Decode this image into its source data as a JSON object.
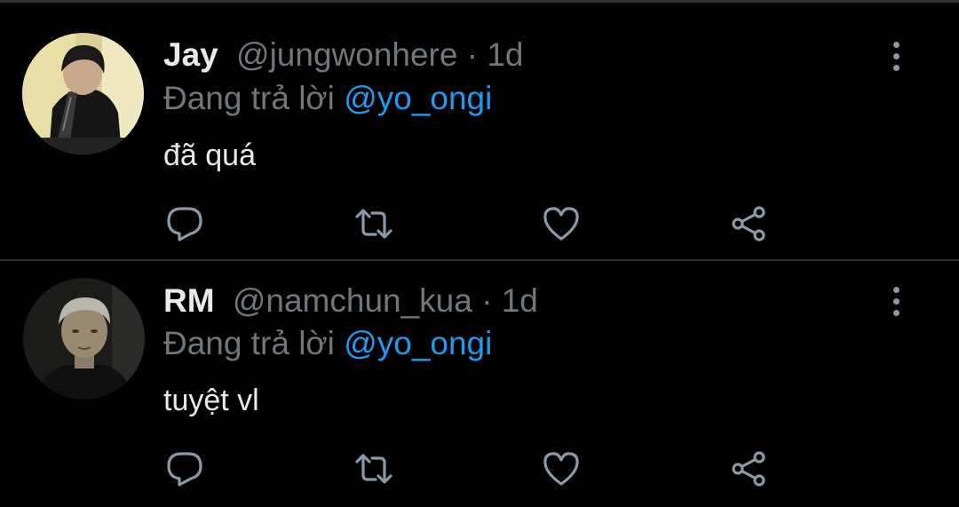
{
  "tweets": [
    {
      "display_name": "Jay",
      "handle": "@jungwonhere",
      "separator": "·",
      "time": "1d",
      "replying_prefix": "Đang trả lời",
      "replying_to": "@yo_ongi",
      "text": "đã quá",
      "avatar_icon": "avatar-photo"
    },
    {
      "display_name": "RM",
      "handle": "@namchun_kua",
      "separator": "·",
      "time": "1d",
      "replying_prefix": "Đang trả lời",
      "replying_to": "@yo_ongi",
      "text": "tuyệt vl",
      "avatar_icon": "avatar-photo"
    }
  ],
  "icons": {
    "reply": "reply-icon",
    "retweet": "retweet-icon",
    "like": "heart-icon",
    "share": "share-icon",
    "more": "more-vertical-icon"
  },
  "colors": {
    "background": "#000000",
    "primary_text": "#e7e9ea",
    "secondary_text": "#71767b",
    "mention": "#1d9bf0",
    "icon": "#8b98a5",
    "divider": "#2f3336"
  }
}
